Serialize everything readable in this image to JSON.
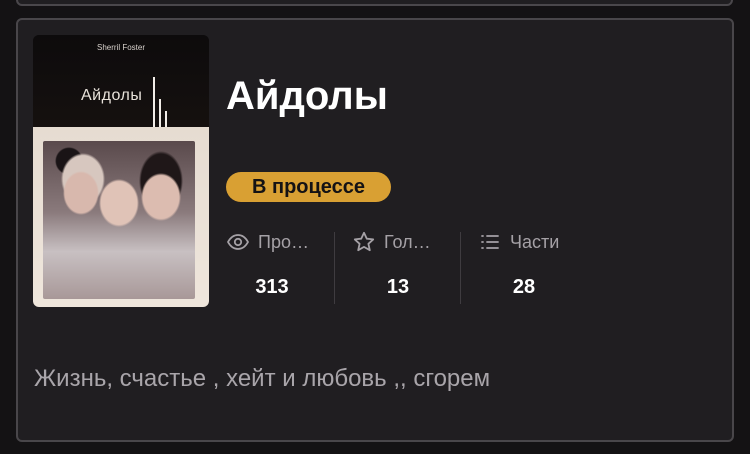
{
  "story": {
    "title": "Айдолы",
    "status": "В процессе",
    "description": "Жизнь, счастье , хейт и любовь ,, сгорем",
    "cover": {
      "author": "Sherril Foster",
      "title": "Айдолы"
    }
  },
  "stats": [
    {
      "icon": "eye-icon",
      "label": "Про…",
      "value": "313"
    },
    {
      "icon": "star-icon",
      "label": "Гол…",
      "value": "13"
    },
    {
      "icon": "list-icon",
      "label": "Части",
      "value": "28"
    }
  ],
  "colors": {
    "background": "#141214",
    "card": "#201e21",
    "accent": "#d9a033",
    "muted_text": "#a5a1a6"
  }
}
